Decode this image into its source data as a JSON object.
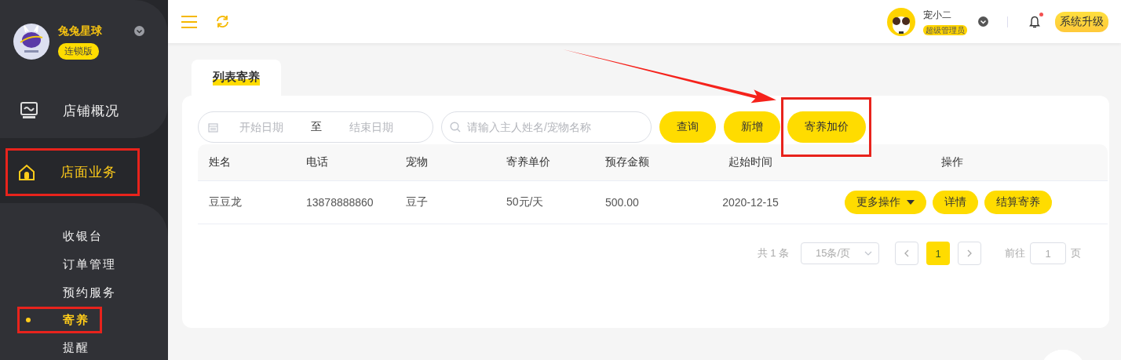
{
  "store": {
    "name": "兔兔星球",
    "edition": "连锁版"
  },
  "nav": [
    {
      "label": "店铺概况",
      "kind": "monitor",
      "selected": false,
      "highlighted": false
    },
    {
      "label": "店面业务",
      "kind": "house",
      "selected": true,
      "highlighted": true,
      "children": [
        {
          "label": "收银台",
          "selected": false,
          "highlighted": false
        },
        {
          "label": "订单管理",
          "selected": false,
          "highlighted": false
        },
        {
          "label": "预约服务",
          "selected": false,
          "highlighted": false
        },
        {
          "label": "寄养",
          "selected": true,
          "highlighted": true
        },
        {
          "label": "提醒",
          "selected": false,
          "highlighted": false
        }
      ]
    }
  ],
  "user": {
    "name": "宠小二",
    "role": "超级管理员",
    "unread": true
  },
  "upgrade_button": "系统升级",
  "tabs": [
    {
      "label": "列表寄养",
      "selected": true
    }
  ],
  "filters": {
    "start_placeholder": "开始日期",
    "separator": "至",
    "end_placeholder": "结束日期",
    "search_placeholder": "请输入主人姓名/宠物名称"
  },
  "toolbar": [
    {
      "label": "查询",
      "highlighted": false
    },
    {
      "label": "新增",
      "highlighted": false
    },
    {
      "label": "寄养加价",
      "highlighted": true
    }
  ],
  "table": {
    "columns": [
      "姓名",
      "电话",
      "宠物",
      "寄养单价",
      "预存金额",
      "起始时间",
      "操作"
    ],
    "rows": [
      {
        "cells": [
          "豆豆龙",
          "13878888860",
          "豆子",
          "50元/天",
          "500.00",
          "2020-12-15"
        ],
        "actions": [
          {
            "label": "更多操作",
            "kind": "dropdown"
          },
          {
            "label": "详情",
            "kind": "button"
          },
          {
            "label": "结算寄养",
            "kind": "button"
          }
        ]
      }
    ]
  },
  "pagination": {
    "total": "共 1 条",
    "page_size": "15条/页",
    "pages": [
      {
        "label": "1",
        "selected": true
      }
    ],
    "goto_label": "前往",
    "goto_value": "1",
    "goto_suffix": "页"
  }
}
